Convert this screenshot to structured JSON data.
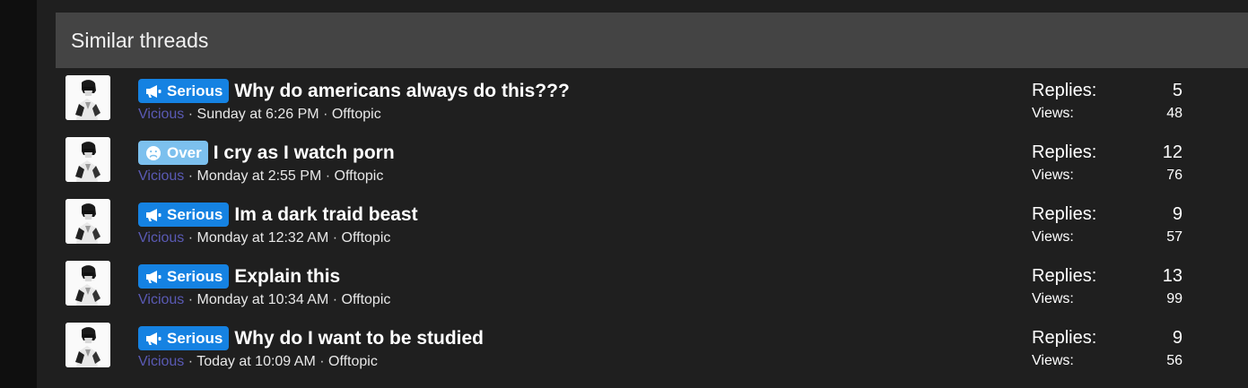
{
  "block": {
    "title": "Similar threads"
  },
  "colors": {
    "serious_prefix": "#1582e2",
    "over_prefix": "#7cc0ee",
    "author_link": "#5a5ab4"
  },
  "threads": [
    {
      "prefix": "Serious",
      "prefix_type": "serious",
      "prefix_icon": "megaphone-icon",
      "title": "Why do americans always do this???",
      "author": "Vicious",
      "sep1": "·",
      "date": "Sunday at 6:26 PM",
      "sep2": "·",
      "forum": "Offtopic",
      "replies_label": "Replies:",
      "replies": "5",
      "views_label": "Views:",
      "views": "48"
    },
    {
      "prefix": "Over",
      "prefix_type": "over",
      "prefix_icon": "sad-face-icon",
      "title": "I cry as I watch porn",
      "author": "Vicious",
      "sep1": "·",
      "date": "Monday at 2:55 PM",
      "sep2": "·",
      "forum": "Offtopic",
      "replies_label": "Replies:",
      "replies": "12",
      "views_label": "Views:",
      "views": "76"
    },
    {
      "prefix": "Serious",
      "prefix_type": "serious",
      "prefix_icon": "megaphone-icon",
      "title": "Im a dark traid beast",
      "author": "Vicious",
      "sep1": "·",
      "date": "Monday at 12:32 AM",
      "sep2": "·",
      "forum": "Offtopic",
      "replies_label": "Replies:",
      "replies": "9",
      "views_label": "Views:",
      "views": "57"
    },
    {
      "prefix": "Serious",
      "prefix_type": "serious",
      "prefix_icon": "megaphone-icon",
      "title": "Explain this",
      "author": "Vicious",
      "sep1": "·",
      "date": "Monday at 10:34 AM",
      "sep2": "·",
      "forum": "Offtopic",
      "replies_label": "Replies:",
      "replies": "13",
      "views_label": "Views:",
      "views": "99"
    },
    {
      "prefix": "Serious",
      "prefix_type": "serious",
      "prefix_icon": "megaphone-icon",
      "title": "Why do I want to be studied",
      "author": "Vicious",
      "sep1": "·",
      "date": "Today at 10:09 AM",
      "sep2": "·",
      "forum": "Offtopic",
      "replies_label": "Replies:",
      "replies": "9",
      "views_label": "Views:",
      "views": "56"
    }
  ]
}
